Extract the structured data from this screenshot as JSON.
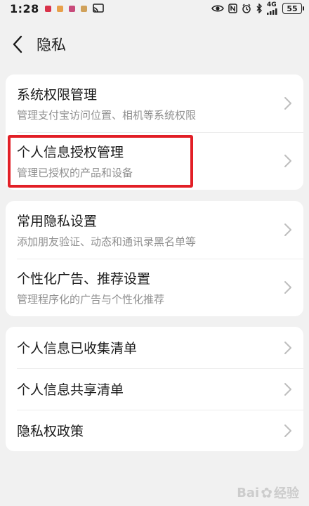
{
  "status_bar": {
    "time": "1:28",
    "network": "4G",
    "battery": "55",
    "mini_icon_colors": [
      "#d9334a",
      "#e8a04a",
      "#c84b7b",
      "#d0a15a"
    ]
  },
  "header": {
    "title": "隐私",
    "back_icon": "chevron-left-icon"
  },
  "groups": [
    {
      "items": [
        {
          "title": "系统权限管理",
          "subtitle": "管理支付宝访问位置、相机等系统权限"
        },
        {
          "title": "个人信息授权管理",
          "subtitle": "管理已授权的产品和设备"
        }
      ]
    },
    {
      "items": [
        {
          "title": "常用隐私设置",
          "subtitle": "添加朋友验证、动态和通讯录黑名单等"
        },
        {
          "title": "个性化广告、推荐设置",
          "subtitle": "管理程序化的广告与个性化推荐"
        }
      ]
    },
    {
      "items": [
        {
          "title": "个人信息已收集清单"
        },
        {
          "title": "个人信息共享清单"
        },
        {
          "title": "隐私权政策"
        }
      ]
    }
  ],
  "highlight_color": "#e21f26",
  "watermark": {
    "text": "Bai",
    "suffix": "经验"
  }
}
